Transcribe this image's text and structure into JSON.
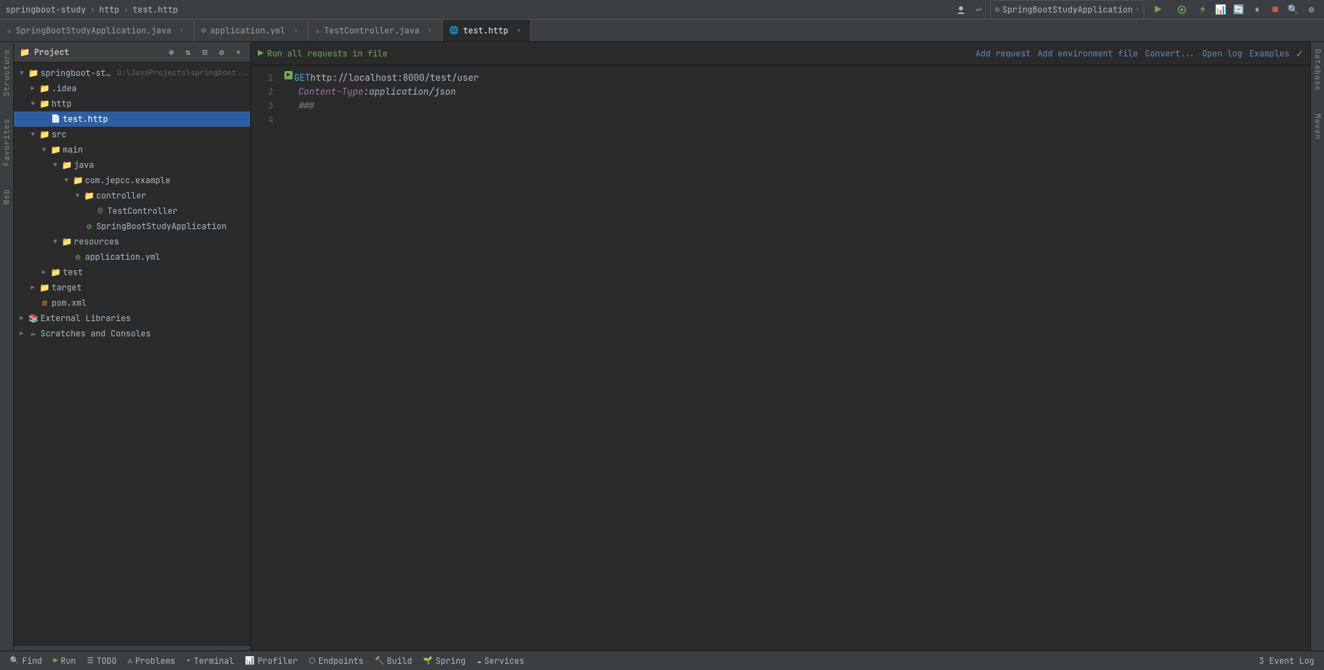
{
  "titleBar": {
    "breadcrumbs": [
      "springboot-study",
      "http",
      "test.http"
    ],
    "separators": [
      ">",
      ">"
    ]
  },
  "toolbar": {
    "runConfig": "SpringBootStudyApplication",
    "runBtn": "▶",
    "debugBtn": "🐛"
  },
  "tabs": [
    {
      "id": "SpringBootStudyApplication",
      "label": "SpringBootStudyApplication.java",
      "icon": "☕",
      "color": "#5c8abf",
      "active": false,
      "closable": true
    },
    {
      "id": "application.yml",
      "label": "application.yml",
      "icon": "⚙",
      "color": "#6fa855",
      "active": false,
      "closable": true
    },
    {
      "id": "TestController.java",
      "label": "TestController.java",
      "icon": "☕",
      "color": "#5c8abf",
      "active": false,
      "closable": true
    },
    {
      "id": "test.http",
      "label": "test.http",
      "icon": "🌐",
      "color": "#9876aa",
      "active": true,
      "closable": true
    }
  ],
  "projectPanel": {
    "title": "Project",
    "items": [
      {
        "id": "springboot-study-root",
        "indent": 0,
        "arrow": "▶",
        "expanded": true,
        "icon": "📁",
        "iconClass": "folder-yellow",
        "label": "springboot-study",
        "hint": "D:\\JavaProjects\\springboot...",
        "selected": false
      },
      {
        "id": "idea",
        "indent": 1,
        "arrow": "▶",
        "expanded": false,
        "icon": "📁",
        "iconClass": "folder-yellow",
        "label": ".idea",
        "hint": "",
        "selected": false
      },
      {
        "id": "http-folder",
        "indent": 1,
        "arrow": "▶",
        "expanded": true,
        "icon": "📁",
        "iconClass": "folder-yellow",
        "label": "http",
        "hint": "",
        "selected": false
      },
      {
        "id": "test-http",
        "indent": 2,
        "arrow": "",
        "icon": "📄",
        "iconClass": "http-icon",
        "label": "test.http",
        "hint": "",
        "selected": true
      },
      {
        "id": "src",
        "indent": 1,
        "arrow": "▶",
        "expanded": true,
        "icon": "📁",
        "iconClass": "folder-yellow",
        "label": "src",
        "hint": "",
        "selected": false
      },
      {
        "id": "main",
        "indent": 2,
        "arrow": "▶",
        "expanded": true,
        "icon": "📁",
        "iconClass": "folder-yellow",
        "label": "main",
        "hint": "",
        "selected": false
      },
      {
        "id": "java",
        "indent": 3,
        "arrow": "▶",
        "expanded": true,
        "icon": "📁",
        "iconClass": "folder-blue",
        "label": "java",
        "hint": "",
        "selected": false
      },
      {
        "id": "com-jepcc-example",
        "indent": 4,
        "arrow": "▶",
        "expanded": true,
        "icon": "📁",
        "iconClass": "folder-blue",
        "label": "com.jepcc.example",
        "hint": "",
        "selected": false
      },
      {
        "id": "controller",
        "indent": 5,
        "arrow": "▶",
        "expanded": true,
        "icon": "📁",
        "iconClass": "folder-blue",
        "label": "controller",
        "hint": "",
        "selected": false
      },
      {
        "id": "TestController",
        "indent": 6,
        "arrow": "",
        "icon": "©",
        "iconClass": "spring-icon",
        "label": "TestController",
        "hint": "",
        "selected": false
      },
      {
        "id": "SpringBootStudyApplication",
        "indent": 5,
        "arrow": "",
        "icon": "⚙",
        "iconClass": "spring-icon",
        "label": "SpringBootStudyApplication",
        "hint": "",
        "selected": false
      },
      {
        "id": "resources",
        "indent": 3,
        "arrow": "▶",
        "expanded": true,
        "icon": "📁",
        "iconClass": "folder-yellow",
        "label": "resources",
        "hint": "",
        "selected": false
      },
      {
        "id": "application-yml",
        "indent": 4,
        "arrow": "",
        "icon": "⚙",
        "iconClass": "yaml-icon",
        "label": "application.yml",
        "hint": "",
        "selected": false
      },
      {
        "id": "test",
        "indent": 2,
        "arrow": "▶",
        "expanded": false,
        "icon": "📁",
        "iconClass": "folder-yellow",
        "label": "test",
        "hint": "",
        "selected": false
      },
      {
        "id": "target",
        "indent": 1,
        "arrow": "▶",
        "expanded": false,
        "icon": "📁",
        "iconClass": "folder-yellow",
        "label": "target",
        "hint": "",
        "selected": false
      },
      {
        "id": "pom-xml",
        "indent": 1,
        "arrow": "",
        "icon": "m",
        "iconClass": "maven-icon",
        "label": "pom.xml",
        "hint": "",
        "selected": false
      },
      {
        "id": "external-libraries",
        "indent": 0,
        "arrow": "▶",
        "expanded": false,
        "icon": "📚",
        "iconClass": "",
        "label": "External Libraries",
        "hint": "",
        "selected": false
      },
      {
        "id": "scratches-consoles",
        "indent": 0,
        "arrow": "▶",
        "expanded": false,
        "icon": "✏",
        "iconClass": "",
        "label": "Scratches and Consoles",
        "hint": "",
        "selected": false
      }
    ]
  },
  "httpToolbar": {
    "runAllLabel": "Run all requests in file",
    "links": [
      "Add request",
      "Add environment file",
      "Convert...",
      "Open log",
      "Examples"
    ]
  },
  "editor": {
    "lines": [
      {
        "num": 1,
        "hasRun": true,
        "content": "GET http://localhost:8000/test/user",
        "type": "request"
      },
      {
        "num": 2,
        "hasRun": false,
        "content": "Content-Type: application/json",
        "type": "header"
      },
      {
        "num": 3,
        "hasRun": false,
        "content": "###",
        "type": "comment"
      },
      {
        "num": 4,
        "hasRun": false,
        "content": "",
        "type": "empty"
      }
    ]
  },
  "rightSidebar": {
    "labels": [
      "Database",
      "Maven"
    ]
  },
  "leftEdge": {
    "labels": [
      "Structure",
      "Favorites",
      "Web"
    ]
  },
  "statusBar": {
    "items": [
      {
        "id": "find",
        "icon": "🔍",
        "label": "Find"
      },
      {
        "id": "run",
        "icon": "▶",
        "label": "Run"
      },
      {
        "id": "todo",
        "icon": "☰",
        "label": "TODO"
      },
      {
        "id": "problems",
        "icon": "⚠",
        "label": "Problems"
      },
      {
        "id": "terminal",
        "icon": "▸",
        "label": "Terminal"
      },
      {
        "id": "profiler",
        "icon": "📊",
        "label": "Profiler"
      },
      {
        "id": "endpoints",
        "icon": "⬡",
        "label": "Endpoints"
      },
      {
        "id": "build",
        "icon": "🔨",
        "label": "Build"
      },
      {
        "id": "spring",
        "icon": "🌱",
        "label": "Spring"
      },
      {
        "id": "services",
        "icon": "☁",
        "label": "Services"
      }
    ],
    "rightItems": [
      {
        "id": "event-log",
        "label": "3 Event Log"
      }
    ]
  }
}
